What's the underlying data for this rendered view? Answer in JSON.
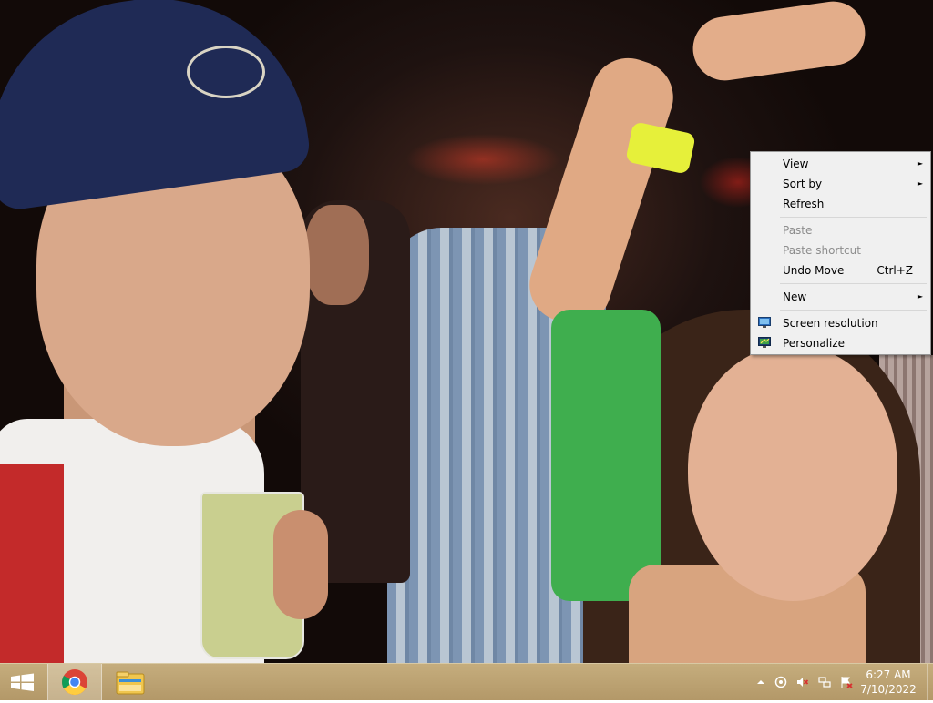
{
  "context_menu": {
    "items": [
      {
        "label": "View",
        "has_submenu": true,
        "enabled": true
      },
      {
        "label": "Sort by",
        "has_submenu": true,
        "enabled": true
      },
      {
        "label": "Refresh",
        "enabled": true
      },
      {
        "label": "Paste",
        "enabled": false
      },
      {
        "label": "Paste shortcut",
        "enabled": false
      },
      {
        "label": "Undo Move",
        "shortcut": "Ctrl+Z",
        "enabled": true
      },
      {
        "label": "New",
        "has_submenu": true,
        "enabled": true
      },
      {
        "label": "Screen resolution",
        "icon": "screen-resolution-icon",
        "enabled": true
      },
      {
        "label": "Personalize",
        "icon": "personalize-icon",
        "enabled": true
      }
    ],
    "submenu_arrow": "►"
  },
  "taskbar": {
    "pinned": [
      {
        "name": "Google Chrome",
        "icon": "chrome-icon",
        "active": true
      },
      {
        "name": "File Explorer",
        "icon": "file-explorer-icon",
        "active": false
      }
    ],
    "tray_icons": [
      "show-hidden-icons-icon",
      "sync-icon",
      "volume-muted-icon",
      "network-icon",
      "action-center-icon"
    ],
    "clock": {
      "time": "6:27 AM",
      "date": "7/10/2022"
    }
  },
  "colors": {
    "taskbar": "#b9a070",
    "menu_bg": "#f0f0f0",
    "menu_disabled": "#8d8d8d"
  }
}
